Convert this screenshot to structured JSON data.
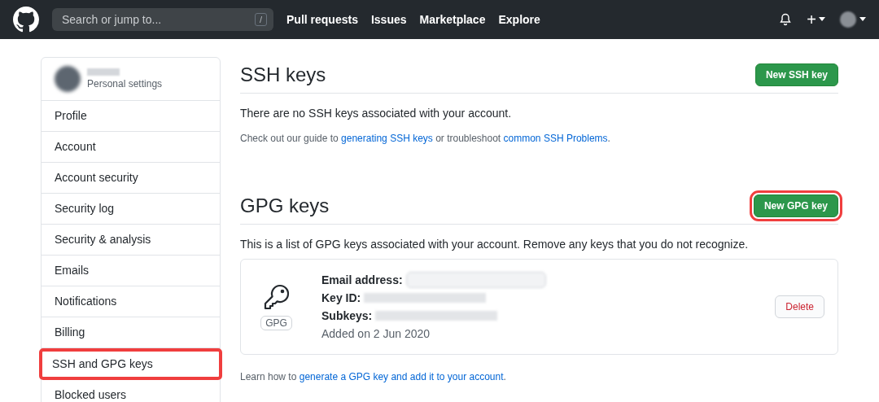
{
  "header": {
    "search": {
      "placeholder": "Search or jump to...",
      "shortcut": "/"
    },
    "nav": [
      "Pull requests",
      "Issues",
      "Marketplace",
      "Explore"
    ],
    "plus": "+"
  },
  "sidebar": {
    "subtitle": "Personal settings",
    "items": [
      {
        "label": "Profile",
        "selected": false
      },
      {
        "label": "Account",
        "selected": false
      },
      {
        "label": "Account security",
        "selected": false
      },
      {
        "label": "Security log",
        "selected": false
      },
      {
        "label": "Security & analysis",
        "selected": false
      },
      {
        "label": "Emails",
        "selected": false
      },
      {
        "label": "Notifications",
        "selected": false
      },
      {
        "label": "Billing",
        "selected": false
      },
      {
        "label": "SSH and GPG keys",
        "selected": true
      },
      {
        "label": "Blocked users",
        "selected": false
      }
    ]
  },
  "ssh": {
    "title": "SSH keys",
    "button": {
      "label": "New SSH key",
      "highlighted": false
    },
    "empty": "There are no SSH keys associated with your account.",
    "help": [
      {
        "text": "Check out our guide to "
      },
      {
        "text": "generating SSH keys",
        "link": true
      },
      {
        "text": " or troubleshoot "
      },
      {
        "text": "common SSH Problems",
        "link": true
      },
      {
        "text": "."
      }
    ]
  },
  "gpg": {
    "title": "GPG keys",
    "button": {
      "label": "New GPG key",
      "highlighted": true
    },
    "intro": "This is a list of GPG keys associated with your account. Remove any keys that you do not recognize.",
    "keys": [
      {
        "badge": "GPG",
        "fields": [
          {
            "label": "Email address:",
            "boxed": true
          },
          {
            "label": "Key ID:",
            "boxed": false
          },
          {
            "label": "Subkeys:",
            "boxed": false
          }
        ],
        "added": "Added on 2 Jun 2020",
        "delete": "Delete"
      }
    ],
    "help": [
      {
        "text": "Learn how to "
      },
      {
        "text": "generate a GPG key and add it to your account",
        "link": true
      },
      {
        "text": "."
      }
    ]
  }
}
